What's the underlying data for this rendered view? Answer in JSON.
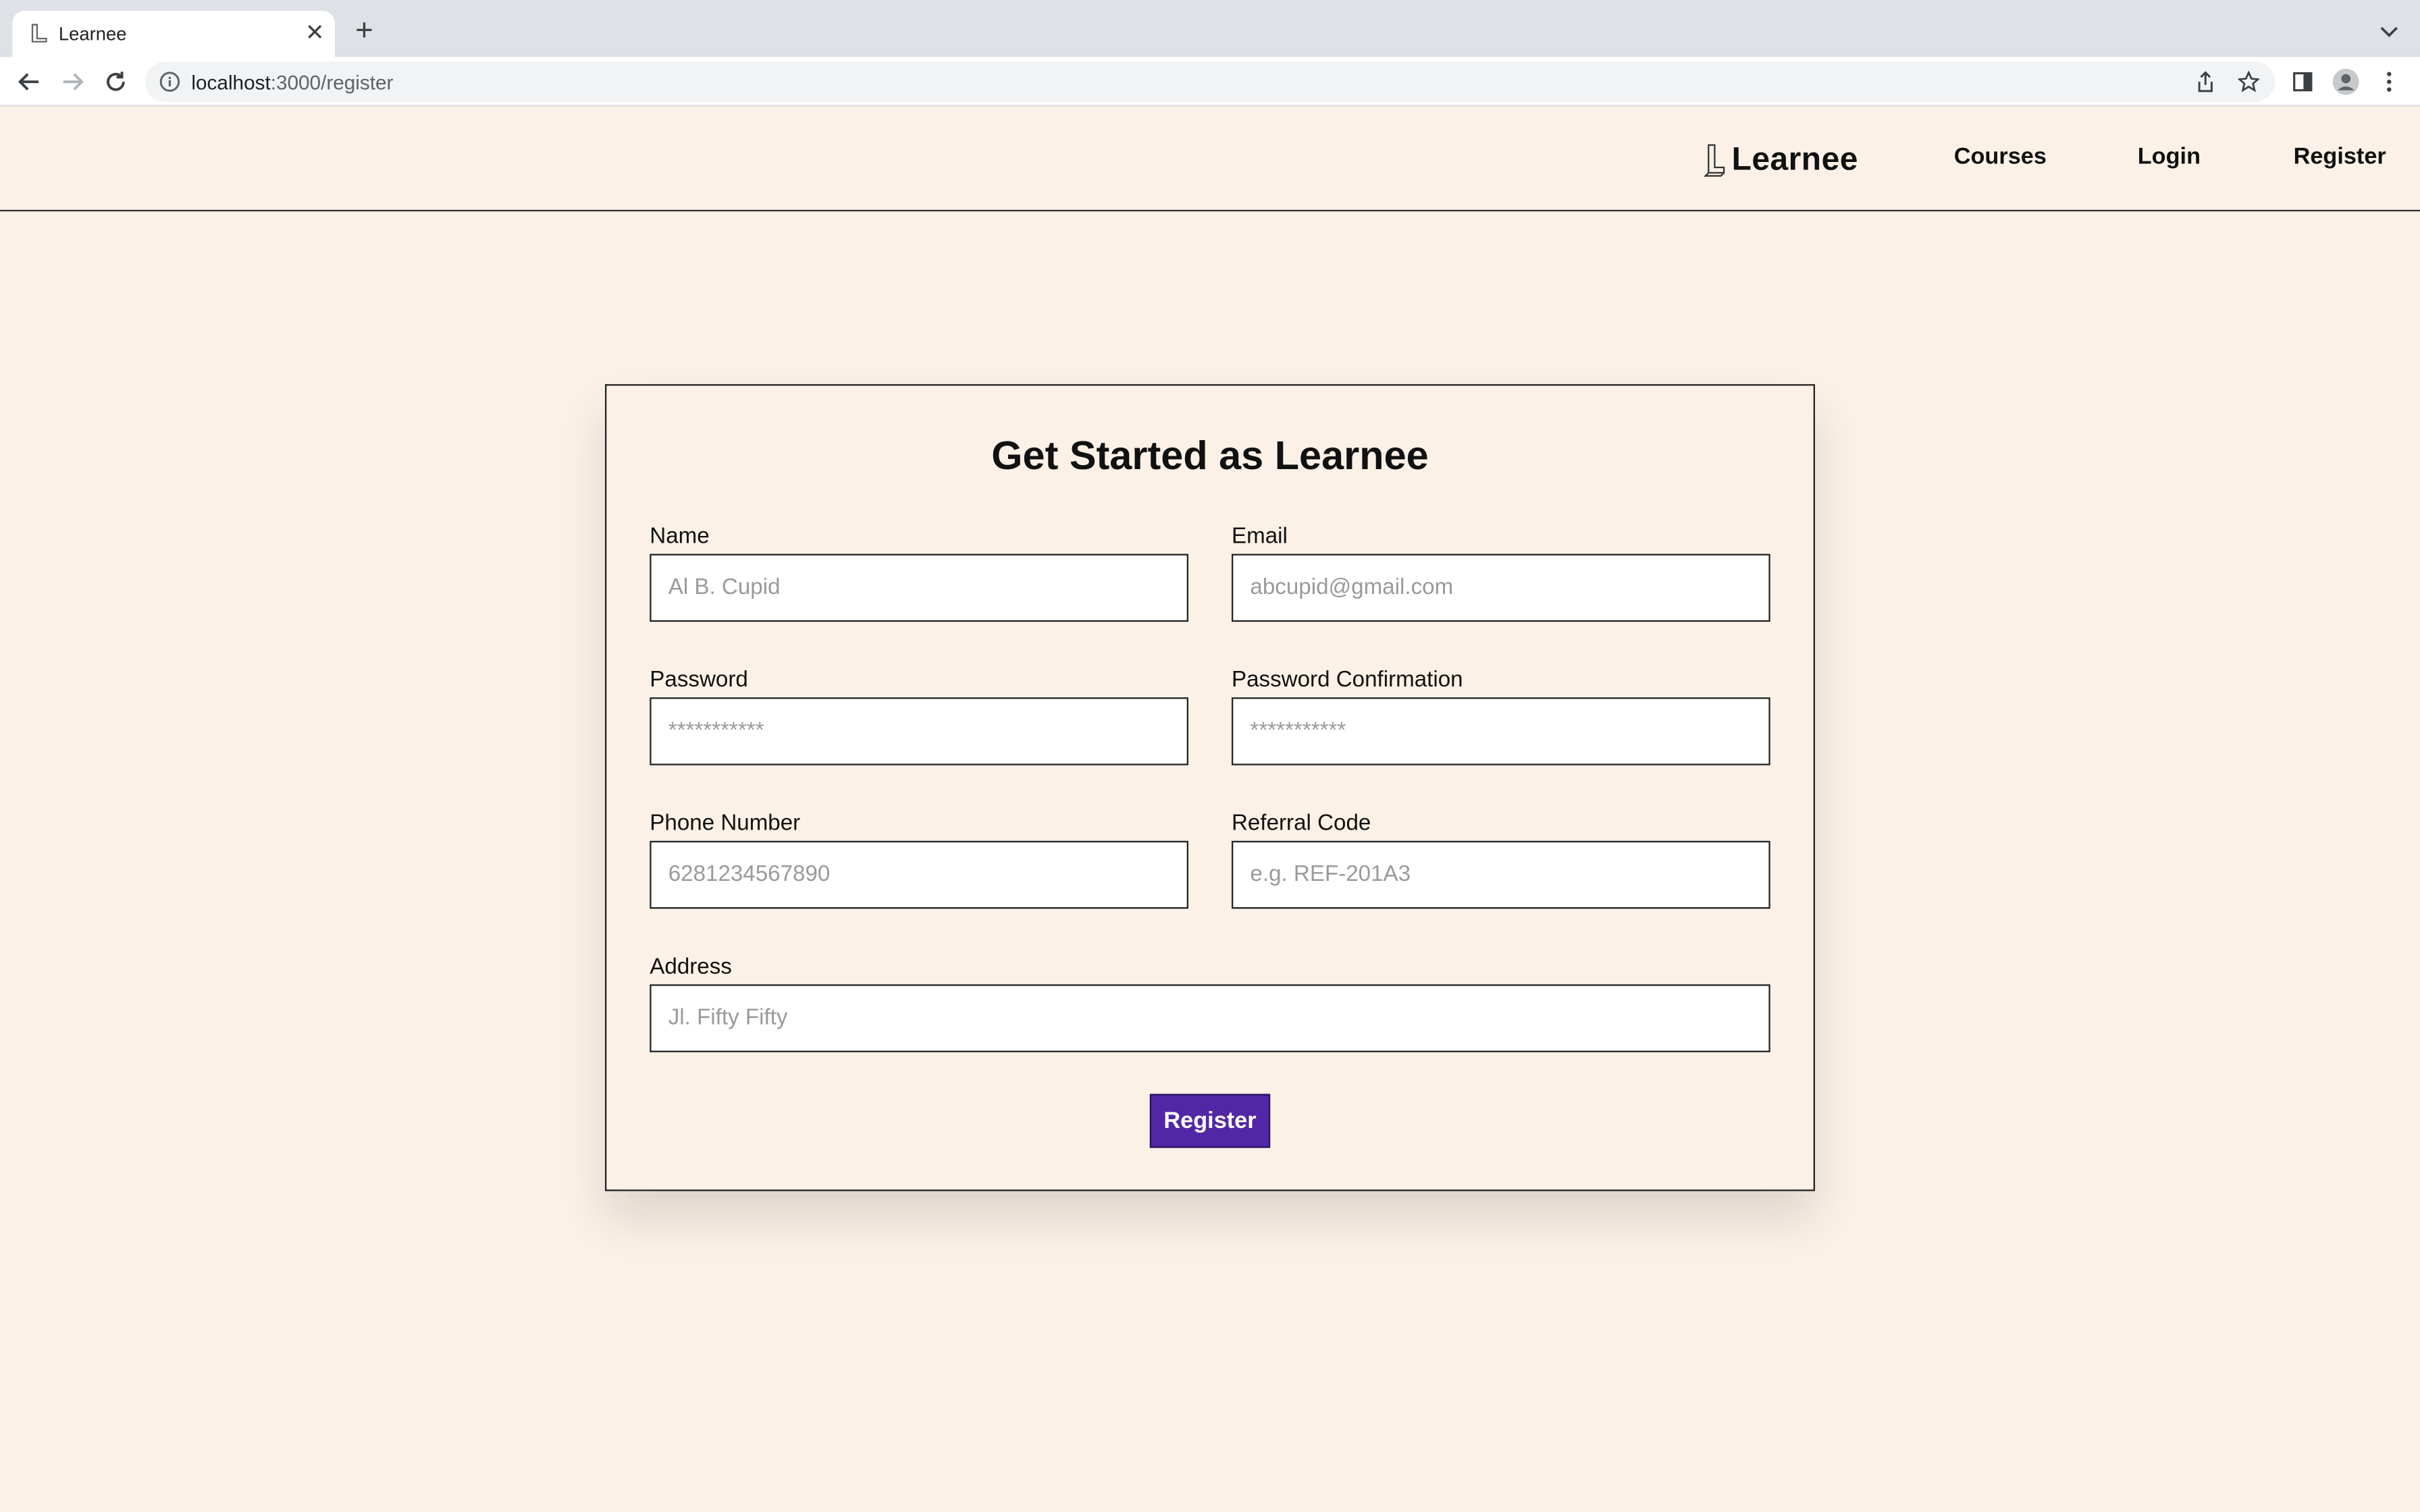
{
  "browser": {
    "tab_title": "Learnee",
    "url_host": "localhost",
    "url_path": ":3000/register",
    "new_tab_symbol": "+",
    "close_symbol": "✕",
    "icons": [
      "back-arrow-icon",
      "forward-arrow-icon",
      "reload-icon",
      "info-icon",
      "share-icon",
      "star-icon",
      "sidebar-icon",
      "profile-icon",
      "kebab-menu-icon",
      "tab-dropdown-icon"
    ]
  },
  "site": {
    "brand": "Learnee",
    "nav": {
      "courses": "Courses",
      "login": "Login",
      "register": "Register"
    }
  },
  "form": {
    "title": "Get Started as Learnee",
    "fields": {
      "name": {
        "label": "Name",
        "placeholder": "Al B. Cupid"
      },
      "email": {
        "label": "Email",
        "placeholder": "abcupid@gmail.com"
      },
      "password": {
        "label": "Password",
        "placeholder": "***********"
      },
      "password_confirmation": {
        "label": "Password Confirmation",
        "placeholder": "***********"
      },
      "phone": {
        "label": "Phone Number",
        "placeholder": "6281234567890"
      },
      "referral": {
        "label": "Referral Code",
        "placeholder": "e.g. REF-201A3"
      },
      "address": {
        "label": "Address",
        "placeholder": "Jl. Fifty Fifty"
      }
    },
    "submit_label": "Register"
  },
  "colors": {
    "page_background": "#FBF1E7",
    "accent": "#5227A6",
    "border": "#222222"
  }
}
